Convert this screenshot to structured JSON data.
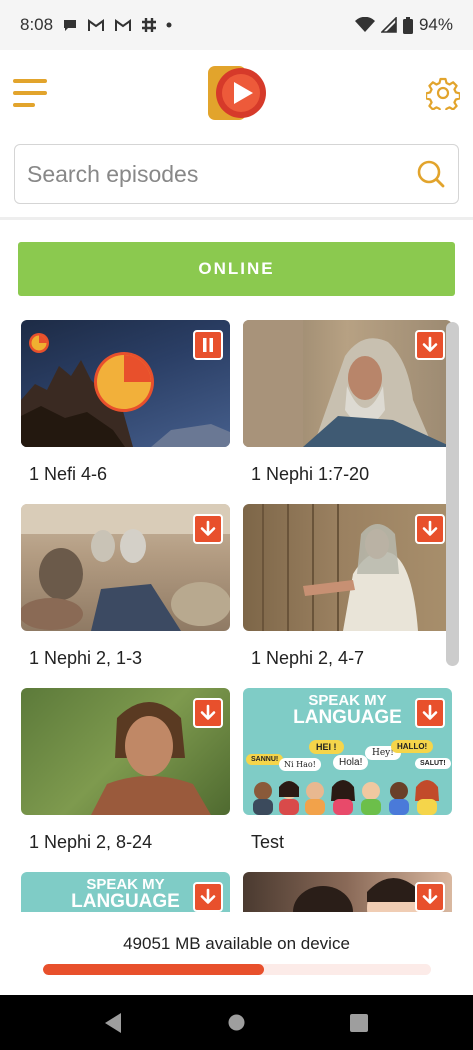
{
  "status_bar": {
    "time": "8:08",
    "battery": "94%"
  },
  "search": {
    "placeholder": "Search episodes"
  },
  "online_label": "ONLINE",
  "episodes": [
    {
      "title": "1 Nefi 4-6",
      "state": "downloading",
      "progress": 0.75
    },
    {
      "title": "1 Nephi 1:7-20",
      "state": "download"
    },
    {
      "title": "1 Nephi 2, 1-3",
      "state": "download"
    },
    {
      "title": "1 Nephi 2, 4-7",
      "state": "download"
    },
    {
      "title": "1 Nephi 2, 8-24",
      "state": "download"
    },
    {
      "title": "Test",
      "state": "download"
    },
    {
      "title": "",
      "state": "download"
    },
    {
      "title": "",
      "state": "download"
    }
  ],
  "thumb_text": {
    "speak_my": "SPEAK MY",
    "language": "LANGUAGE",
    "bubbles": [
      "HEI !",
      "Hey!",
      "HALLO!",
      "SANNU!",
      "Ni Hao!",
      "Hola!",
      "SALUT!"
    ]
  },
  "footer": {
    "storage_text": "49051 MB available on device",
    "storage_used_fraction": 0.57
  },
  "colors": {
    "accent_orange": "#e8502c",
    "online_green": "#8bc94f",
    "icon_gold": "#e2a42c"
  },
  "icons": {
    "menu": "hamburger-menu-icon",
    "settings": "gear-icon",
    "search": "search-icon",
    "download": "download-icon",
    "pause": "pause-icon"
  }
}
